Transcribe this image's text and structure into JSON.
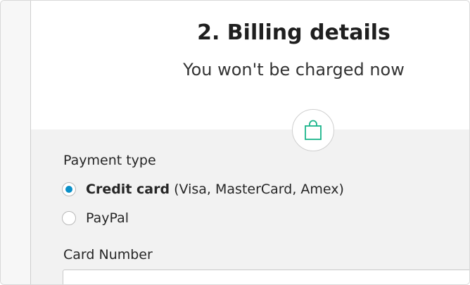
{
  "heading": {
    "title": "2. Billing details",
    "subtitle": "You won't be charged now"
  },
  "icon": "shopping-bag-icon",
  "colors": {
    "accent_green": "#1ab48a",
    "radio_selected": "#0a90c8",
    "panel_bg": "#f2f2f2"
  },
  "payment": {
    "label": "Payment type",
    "options": [
      {
        "name": "Credit card",
        "detail": " (Visa, MasterCard, Amex)",
        "selected": true
      },
      {
        "name": "PayPal",
        "detail": "",
        "selected": false
      }
    ]
  },
  "card_number": {
    "label": "Card Number",
    "value": ""
  }
}
